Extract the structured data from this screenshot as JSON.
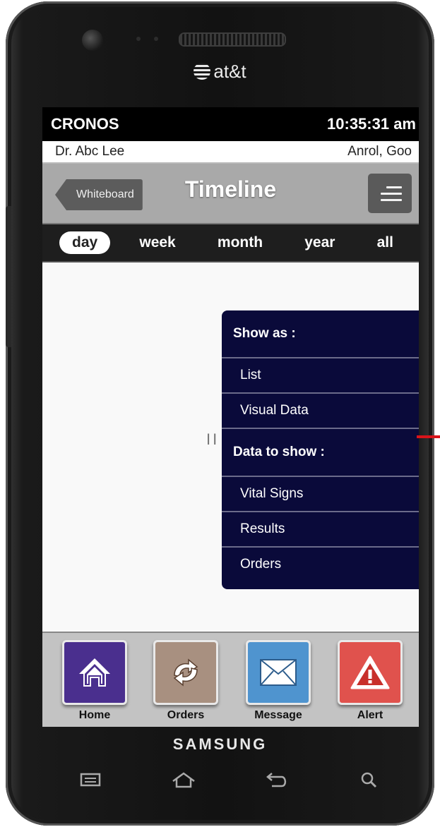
{
  "device": {
    "carrier": "at&t",
    "brand": "SAMSUNG"
  },
  "status_bar": {
    "app_name": "CRONOS",
    "time": "10:35:31 am"
  },
  "user_bar": {
    "doctor": "Dr. Abc Lee",
    "patient": "Anrol, Goo"
  },
  "header": {
    "back_label": "Whiteboard",
    "title": "Timeline"
  },
  "tabs": [
    {
      "label": "day",
      "active": true
    },
    {
      "label": "week",
      "active": false
    },
    {
      "label": "month",
      "active": false
    },
    {
      "label": "year",
      "active": false
    },
    {
      "label": "all",
      "active": false
    }
  ],
  "handle": "II",
  "panel": {
    "show_as_header": "Show as :",
    "show_as_options": [
      "List",
      "Visual Data"
    ],
    "data_header": "Data to show :",
    "data_options": [
      "Vital Signs",
      "Results",
      "Orders"
    ],
    "background_color": "#0a0a3a"
  },
  "dock": [
    {
      "label": "Home",
      "icon": "home-icon",
      "color": "#4a2f8e"
    },
    {
      "label": "Orders",
      "icon": "refresh-icon",
      "color": "#a89080"
    },
    {
      "label": "Message",
      "icon": "envelope-icon",
      "color": "#4f94cf"
    },
    {
      "label": "Alert",
      "icon": "warning-icon",
      "color": "#e0524d"
    }
  ]
}
